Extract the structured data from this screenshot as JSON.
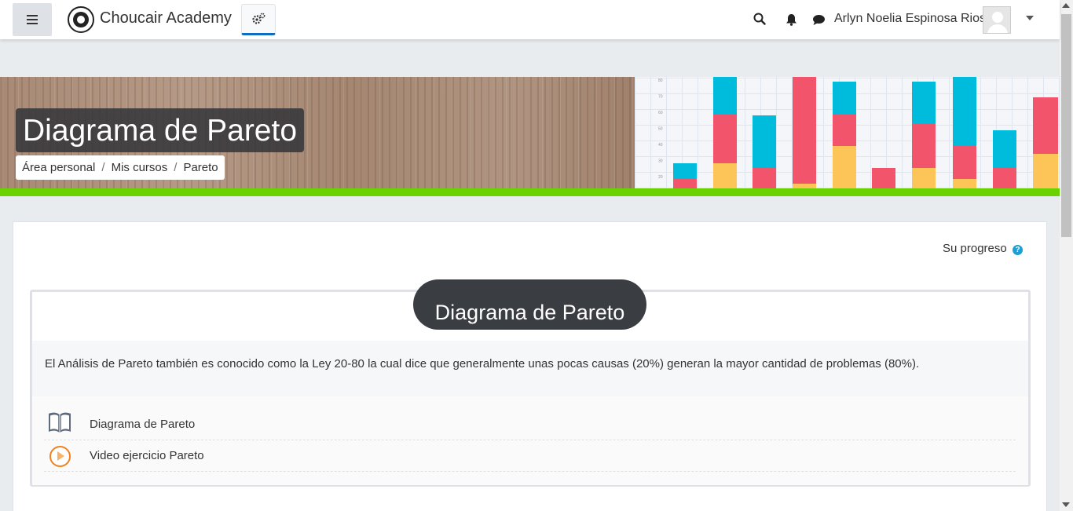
{
  "navbar": {
    "brand_name": "Choucair Academy",
    "user_name": "Arlyn Noelia Espinosa Rios",
    "icons": [
      "menu-icon",
      "brand-logo",
      "cogs-icon",
      "search-icon",
      "bell-icon",
      "chat-icon",
      "avatar",
      "caret-down-icon"
    ]
  },
  "header": {
    "title": "Diagrama de Pareto",
    "breadcrumb": [
      "Área personal",
      "Mis cursos",
      "Pareto"
    ],
    "banner_chart_ticks": [
      "80",
      "70",
      "60",
      "50",
      "40",
      "30",
      "20"
    ]
  },
  "main": {
    "progress_label": "Su progreso",
    "help_icon": "question-circle-icon",
    "section": {
      "title": "Diagrama de Pareto",
      "summary": "El Análisis de Pareto también es conocido como la Ley 20-80 la cual dice que generalmente unas pocas causas (20%) generan la mayor cantidad de problemas (80%).",
      "activities": [
        {
          "label": "Diagrama de Pareto",
          "icon": "book-icon"
        },
        {
          "label": "Video ejercicio Pareto",
          "icon": "play-icon"
        }
      ]
    }
  },
  "colors": {
    "accent_green": "#69d200",
    "title_bg": "#3a3d42",
    "bar_cyan": "#00bcdc",
    "bar_red": "#f2546b",
    "bar_yellow": "#fdc458",
    "play_orange": "#f0811c"
  }
}
